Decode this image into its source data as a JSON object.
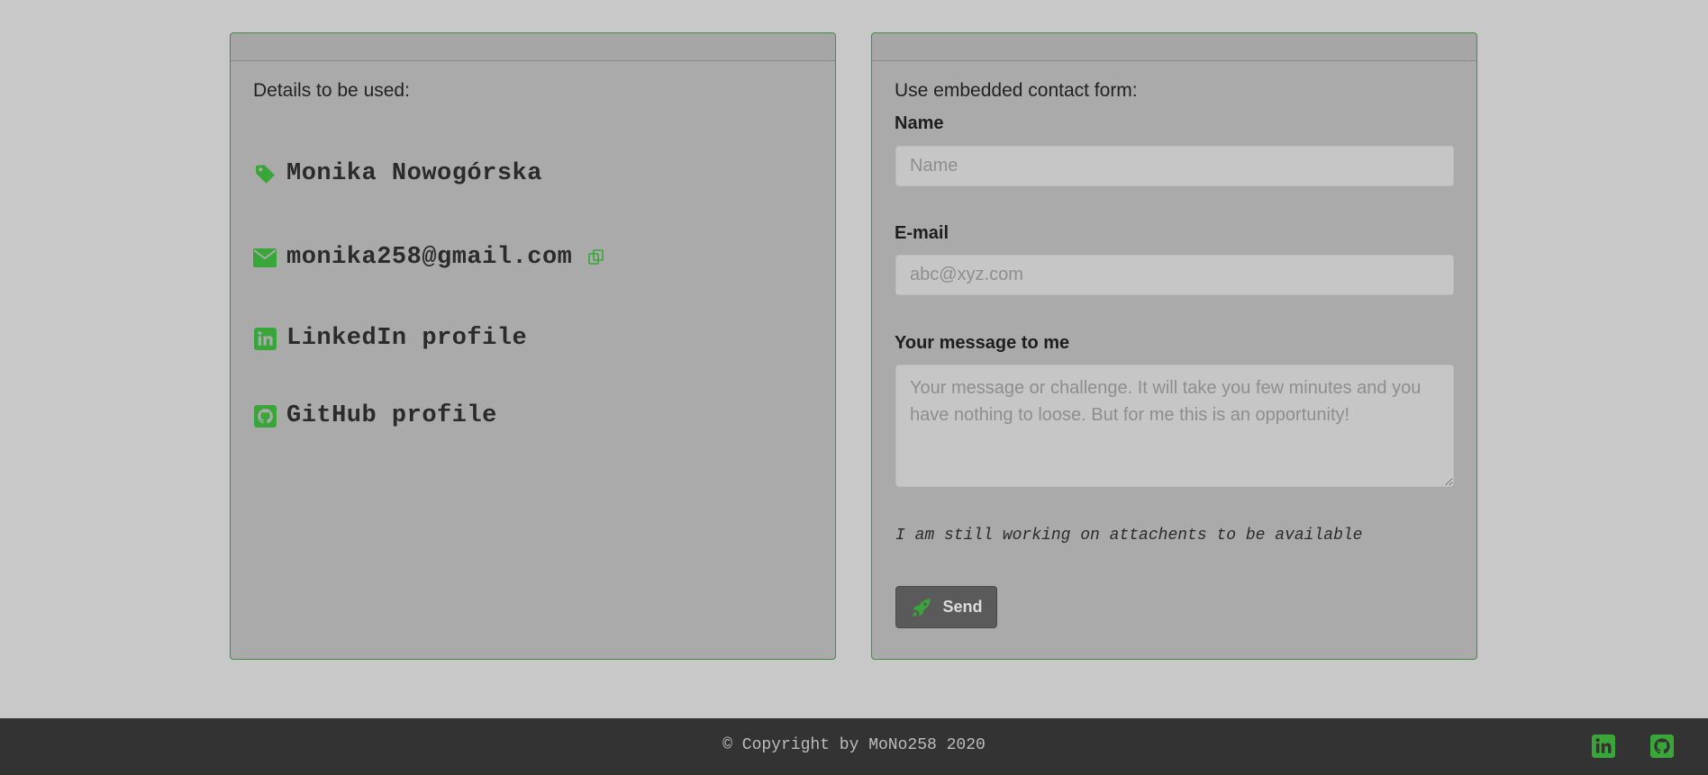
{
  "colors": {
    "accent": "#3aa63a",
    "background": "#c8c8c8",
    "card": "#aaaaaa",
    "footer": "#333333"
  },
  "details_card": {
    "intro": "Details to be used:",
    "items": [
      {
        "icon": "tag-icon",
        "text": "Monika Nowogórska"
      },
      {
        "icon": "envelope-icon",
        "text": "monika258@gmail.com",
        "action_icon": "copy-icon"
      },
      {
        "icon": "linkedin-icon",
        "text": "LinkedIn profile"
      },
      {
        "icon": "github-icon",
        "text": "GitHub profile"
      }
    ]
  },
  "contact_form": {
    "intro": "Use embedded contact form:",
    "name_label": "Name",
    "name_placeholder": "Name",
    "email_label": "E-mail",
    "email_placeholder": "abc@xyz.com",
    "message_label": "Your message to me",
    "message_placeholder": "Your message or challenge. It will take you few minutes and you have nothing to loose. But for me this is an opportunity!",
    "note": "I am still working on attachents to be available",
    "send_label": "Send",
    "send_icon": "rocket-icon"
  },
  "footer": {
    "copyright": "© Copyright by MoNo258 2020",
    "icons": [
      "linkedin-icon",
      "github-icon"
    ]
  }
}
